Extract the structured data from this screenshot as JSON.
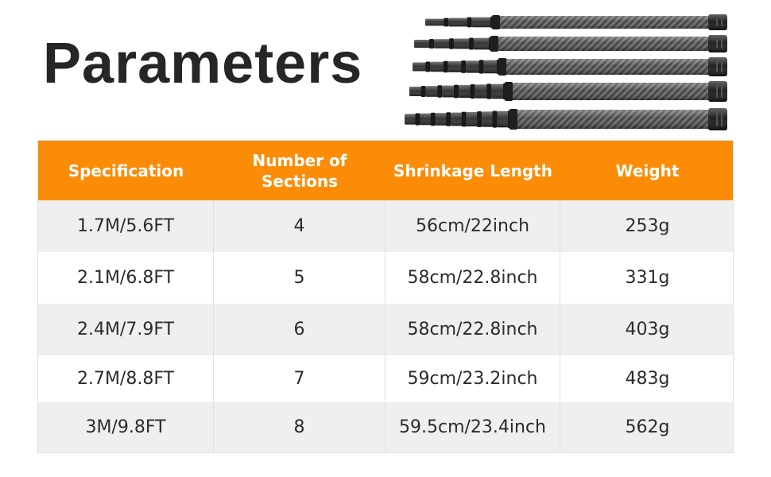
{
  "title": "Parameters",
  "product_image": {
    "icon": "telescopic-pole-icon",
    "count": 5,
    "color": "#2a2a2a",
    "sections": [
      4,
      5,
      6,
      7,
      8
    ]
  },
  "table": {
    "header_color": "#fb8c08",
    "headers": [
      "Specification",
      "Number of Sections",
      "Shrinkage Length",
      "Weight"
    ],
    "rows": [
      [
        "1.7M/5.6FT",
        "4",
        "56cm/22inch",
        "253g"
      ],
      [
        "2.1M/6.8FT",
        "5",
        "58cm/22.8inch",
        "331g"
      ],
      [
        "2.4M/7.9FT",
        "6",
        "58cm/22.8inch",
        "403g"
      ],
      [
        "2.7M/8.8FT",
        "7",
        "59cm/23.2inch",
        "483g"
      ],
      [
        "3M/9.8FT",
        "8",
        "59.5cm/23.4inch",
        "562g"
      ]
    ]
  }
}
